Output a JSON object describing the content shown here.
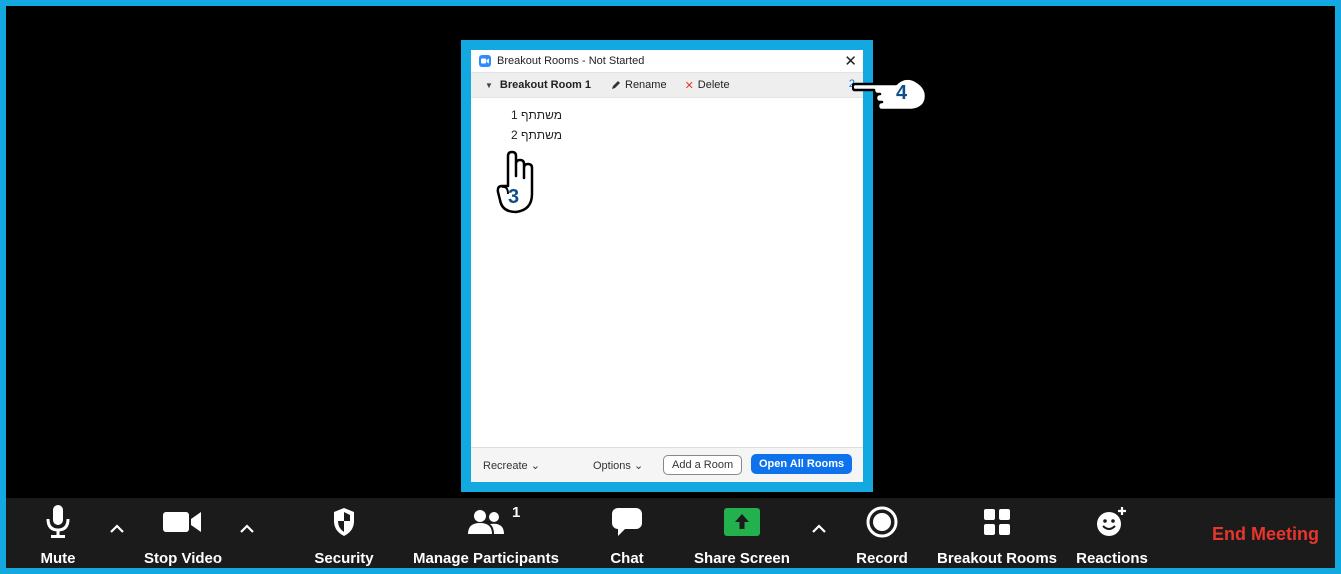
{
  "dialog": {
    "title": "Breakout Rooms - Not Started",
    "room": {
      "name": "Breakout Room 1",
      "rename_label": "Rename",
      "delete_label": "Delete",
      "participant_count": "2",
      "participants": [
        "משתתף 1",
        "משתתף 2"
      ]
    },
    "footer": {
      "recreate_label": "Recreate",
      "options_label": "Options",
      "add_room_label": "Add a Room",
      "open_all_label": "Open All Rooms"
    }
  },
  "annotations": {
    "hand_pointer_number": "3",
    "hand_pointing_right_number": "4"
  },
  "toolbar": {
    "mute_label": "Mute",
    "stop_video_label": "Stop Video",
    "security_label": "Security",
    "participants_label": "Manage Participants",
    "participants_count": "1",
    "chat_label": "Chat",
    "share_screen_label": "Share Screen",
    "record_label": "Record",
    "breakout_rooms_label": "Breakout Rooms",
    "reactions_label": "Reactions",
    "end_meeting_label": "End Meeting"
  },
  "colors": {
    "highlight_border": "#14a8e0",
    "primary_blue": "#0e72ed",
    "share_green": "#22b14c",
    "end_red": "#e8352d",
    "annotation_blue": "#0d4f8a"
  }
}
